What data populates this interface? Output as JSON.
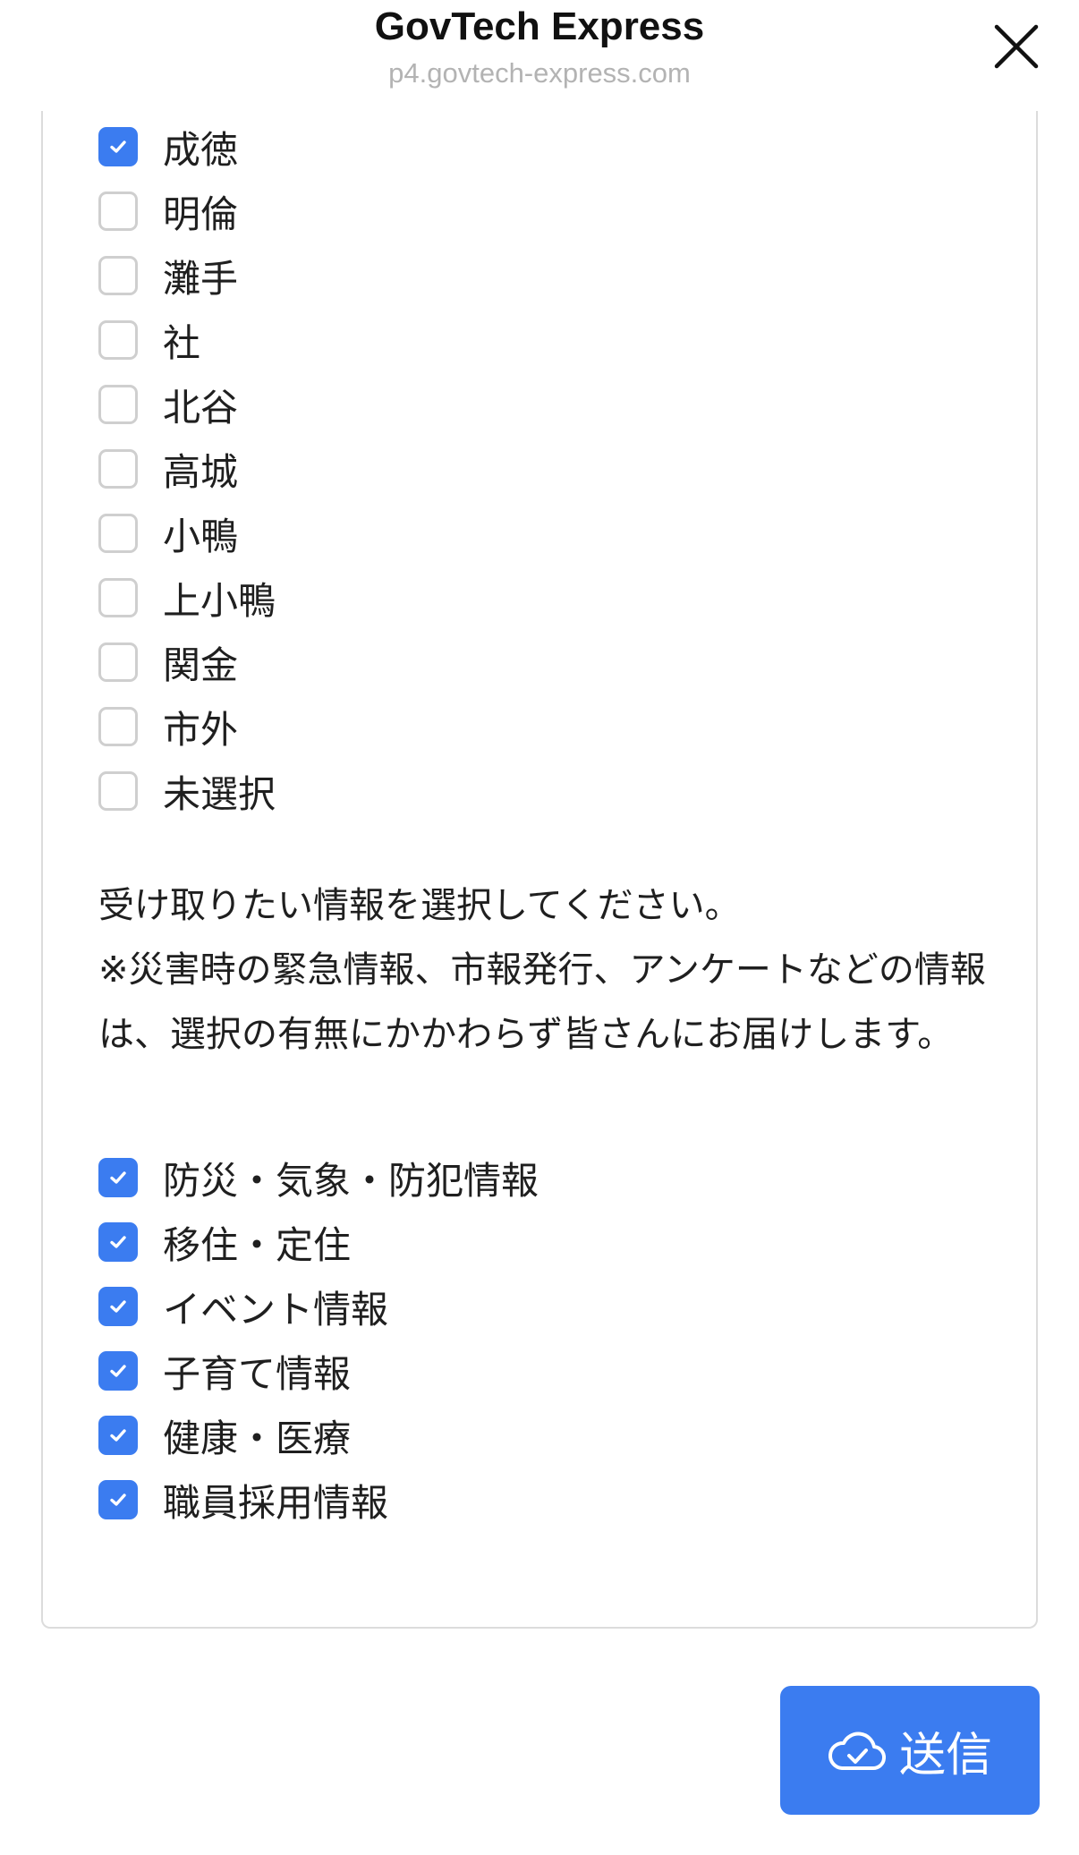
{
  "header": {
    "title": "GovTech Express",
    "url": "p4.govtech-express.com"
  },
  "districts": [
    {
      "label": "成徳",
      "checked": true
    },
    {
      "label": "明倫",
      "checked": false
    },
    {
      "label": "灘手",
      "checked": false
    },
    {
      "label": "社",
      "checked": false
    },
    {
      "label": "北谷",
      "checked": false
    },
    {
      "label": "高城",
      "checked": false
    },
    {
      "label": "小鴨",
      "checked": false
    },
    {
      "label": "上小鴨",
      "checked": false
    },
    {
      "label": "関金",
      "checked": false
    },
    {
      "label": "市外",
      "checked": false
    },
    {
      "label": "未選択",
      "checked": false
    }
  ],
  "instructions": {
    "line1": "受け取りたい情報を選択してください。",
    "line2": "※災害時の緊急情報、市報発行、アンケートなどの情報は、選択の有無にかかわらず皆さんにお届けします。"
  },
  "topics": [
    {
      "label": "防災・気象・防犯情報",
      "checked": true
    },
    {
      "label": "移住・定住",
      "checked": true
    },
    {
      "label": "イベント情報",
      "checked": true
    },
    {
      "label": "子育て情報",
      "checked": true
    },
    {
      "label": "健康・医療",
      "checked": true
    },
    {
      "label": "職員採用情報",
      "checked": true
    }
  ],
  "submit": {
    "label": "送信",
    "icon": "cloud-check-icon"
  },
  "colors": {
    "accent": "#3b7cf0"
  }
}
